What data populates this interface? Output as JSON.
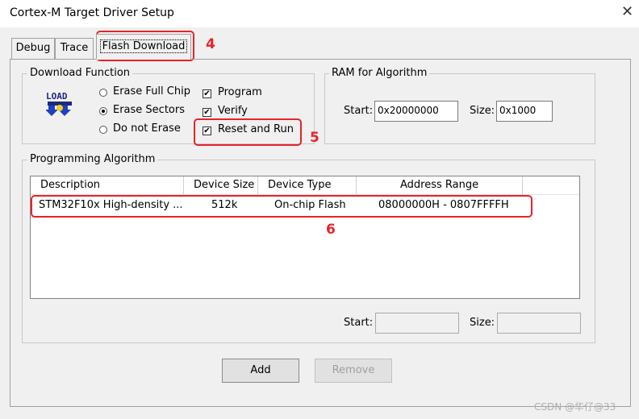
{
  "window": {
    "title": "Cortex-M Target Driver Setup",
    "close_glyph": "✕"
  },
  "tabs": [
    {
      "label": "Debug"
    },
    {
      "label": "Trace"
    },
    {
      "label": "Flash Download"
    }
  ],
  "download_function": {
    "legend": "Download Function",
    "icon_text_top": "LOAD",
    "erase_options": [
      {
        "label": "Erase Full Chip",
        "selected": false
      },
      {
        "label": "Erase Sectors",
        "selected": true
      },
      {
        "label": "Do not Erase",
        "selected": false
      }
    ],
    "checks": [
      {
        "label": "Program",
        "checked": true
      },
      {
        "label": "Verify",
        "checked": true
      },
      {
        "label": "Reset and Run",
        "checked": true
      }
    ]
  },
  "ram": {
    "legend": "RAM for Algorithm",
    "start_label": "Start:",
    "start_value": "0x20000000",
    "size_label": "Size:",
    "size_value": "0x1000"
  },
  "programming_algorithm": {
    "legend": "Programming Algorithm",
    "columns": [
      "Description",
      "Device Size",
      "Device Type",
      "Address Range"
    ],
    "rows": [
      {
        "description": "STM32F10x High-density ...",
        "device_size": "512k",
        "device_type": "On-chip Flash",
        "address_range": "08000000H - 0807FFFFH"
      }
    ],
    "start_label": "Start:",
    "start_value": "",
    "size_label": "Size:",
    "size_value": ""
  },
  "buttons": {
    "add": "Add",
    "remove": "Remove"
  },
  "annotations": {
    "n4": "4",
    "n5": "5",
    "n6": "6",
    "color": "#e8232a"
  },
  "watermark": "CSDN @华仔@33"
}
